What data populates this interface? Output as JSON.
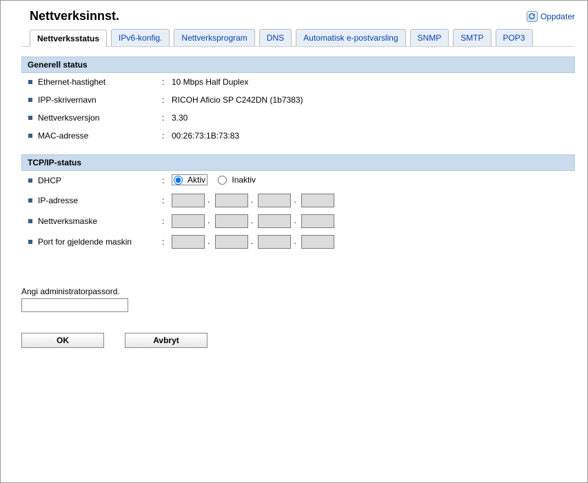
{
  "header": {
    "title": "Nettverksinnst.",
    "refresh_label": "Oppdater"
  },
  "tabs": {
    "network_status": "Nettverksstatus",
    "ipv6": "IPv6-konfig.",
    "network_program": "Nettverksprogram",
    "dns": "DNS",
    "auto_email": "Automatisk e-postvarsling",
    "snmp": "SNMP",
    "smtp": "SMTP",
    "pop3": "POP3"
  },
  "general_status": {
    "header": "Generell status",
    "ethernet_speed_label": "Ethernet-hastighet",
    "ethernet_speed_value": "10 Mbps Half Duplex",
    "ipp_name_label": "IPP-skrivernavn",
    "ipp_name_value": "RICOH Aficio SP C242DN (1b7383)",
    "network_version_label": "Nettverksversjon",
    "network_version_value": "3.30",
    "mac_label": "MAC-adresse",
    "mac_value": "00:26:73:1B:73:83"
  },
  "tcpip_status": {
    "header": "TCP/IP-status",
    "dhcp_label": "DHCP",
    "dhcp_active": "Aktiv",
    "dhcp_inactive": "Inaktiv",
    "ip_label": "IP-adresse",
    "mask_label": "Nettverksmaske",
    "gateway_label": "Port for gjeldende maskin"
  },
  "footer": {
    "pw_prompt": "Angi administratorpassord.",
    "ok": "OK",
    "cancel": "Avbryt"
  }
}
